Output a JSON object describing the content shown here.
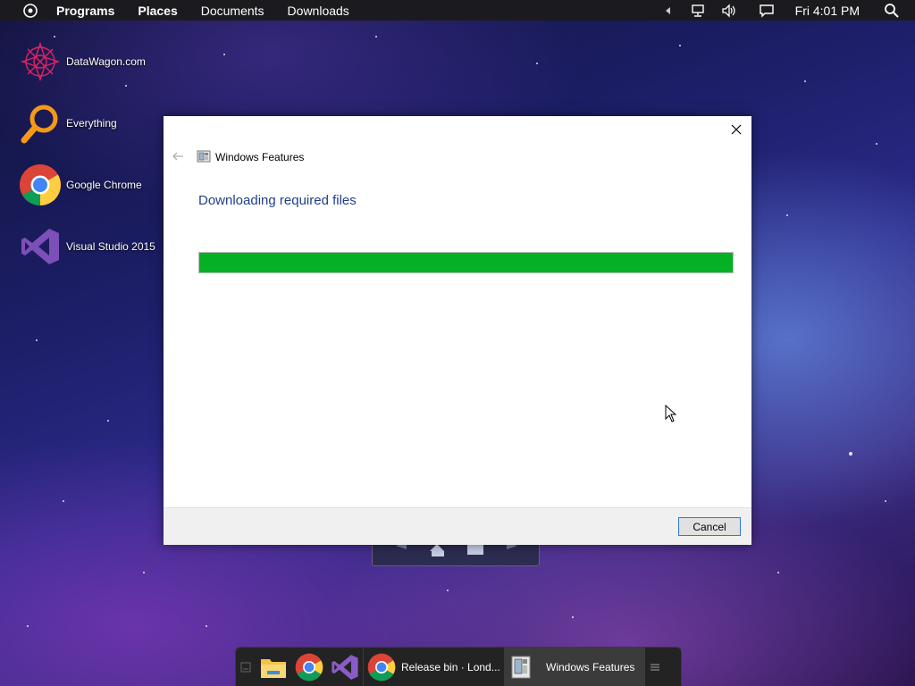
{
  "menubar": {
    "items": [
      "Programs",
      "Places",
      "Documents",
      "Downloads"
    ],
    "clock": "Fri 4:01 PM"
  },
  "desktop_icons": [
    {
      "label": "DataWagon.com",
      "icon": "datawagon-icon"
    },
    {
      "label": "Everything",
      "icon": "everything-search-icon"
    },
    {
      "label": "Google Chrome",
      "icon": "chrome-icon"
    },
    {
      "label": "Visual Studio 2015",
      "icon": "visual-studio-icon"
    }
  ],
  "dialog": {
    "window_title": "Windows Features",
    "heading": "Downloading required files",
    "progress_percent": 100,
    "cancel_label": "Cancel"
  },
  "taskbar": {
    "pinned": [
      "file-explorer-icon",
      "chrome-icon",
      "visual-studio-icon"
    ],
    "tasks": [
      {
        "label": "Release bin · Lond...",
        "icon": "chrome-icon",
        "active": false
      },
      {
        "label": "Windows Features",
        "icon": "windows-features-icon",
        "active": true
      }
    ]
  },
  "colors": {
    "progress_fill": "#06b025",
    "heading": "#1f3f8a",
    "button_border": "#2b7ad8"
  }
}
